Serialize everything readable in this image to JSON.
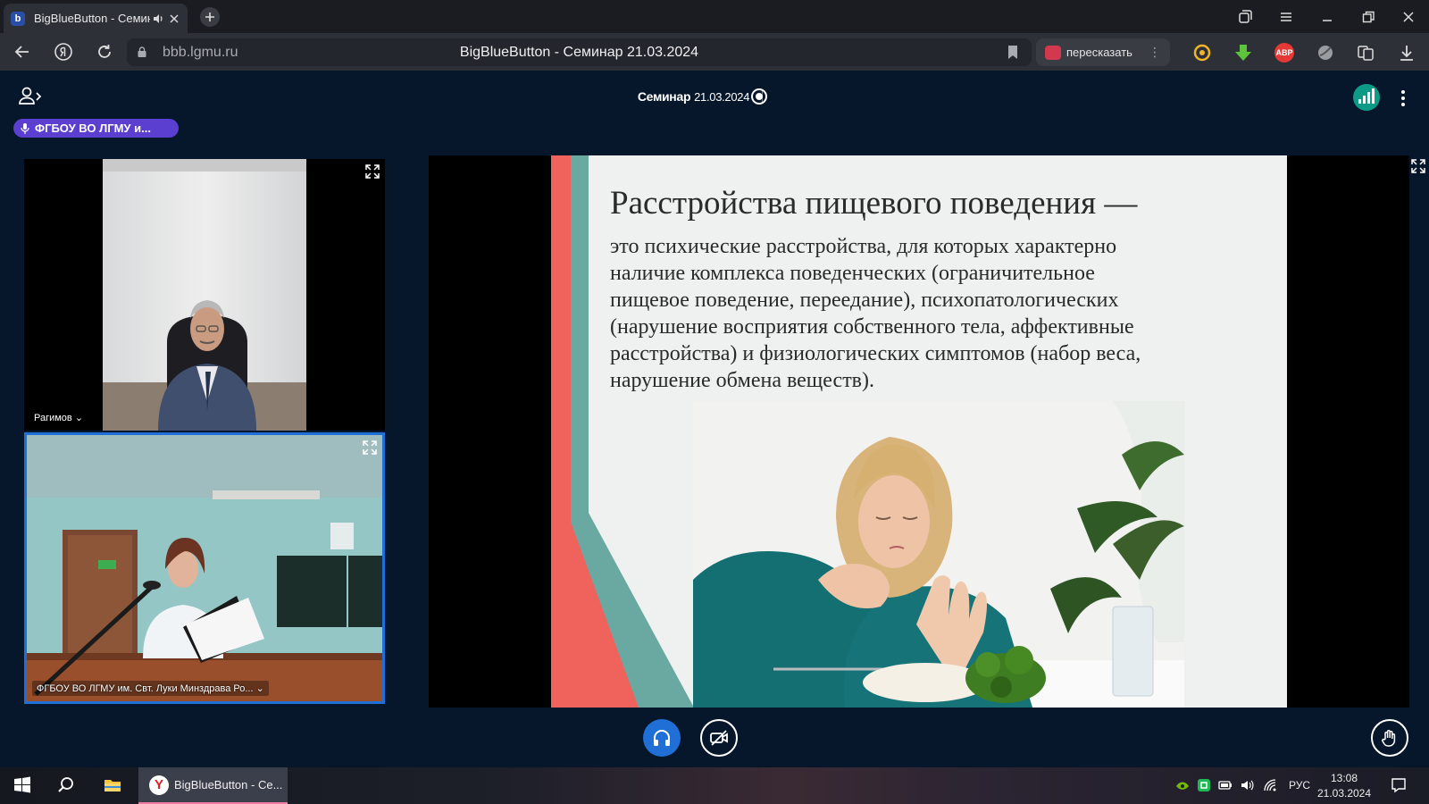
{
  "browser": {
    "tab_title": "BigBlueButton - Семинар 21.03.2024",
    "tab_favicon_letter": "b",
    "url_host": "bbb.lgmu.ru",
    "page_title": "BigBlueButton - Семинар 21.03.2024",
    "retell_label": "пересказать",
    "abp_label": "ABP"
  },
  "meeting": {
    "title_bold": "Семинар",
    "title_date": "21.03.2024",
    "talking_indicator": "ФГБОУ ВО ЛГМУ и..."
  },
  "videos": [
    {
      "label": "Рагимов ⌄"
    },
    {
      "label": "ФГБОУ ВО ЛГМУ им. Свт. Луки Минздрава Ро... ⌄"
    }
  ],
  "slide": {
    "title": "Расстройства пищевого поведения —",
    "body_lines": [
      "это психические расстройства, для которых характерно",
      "наличие комплекса поведенческих (ограничительное",
      "пищевое поведение, переедание), психопатологических",
      "(нарушение восприятия собственного тела, аффективные",
      "расстройства) и физиологических симптомов (набор веса,",
      "нарушение обмена веществ)."
    ]
  },
  "taskbar": {
    "app_label": "BigBlueButton - Се...",
    "lang": "РУС",
    "time": "13:08",
    "date": "21.03.2024"
  },
  "colors": {
    "app_bg": "#06172b",
    "talker_chip": "#5a3fd0",
    "audio_button": "#1f6fd6",
    "stats_button": "#0d9b87",
    "slide_red": "#f0635c",
    "slide_teal": "#6aa9a1"
  },
  "icons": {
    "users": "users-toggle-icon",
    "record": "record-icon",
    "stats": "connection-status-icon",
    "audio": "headphones-icon",
    "video": "camera-off-icon",
    "hand": "raise-hand-icon"
  }
}
